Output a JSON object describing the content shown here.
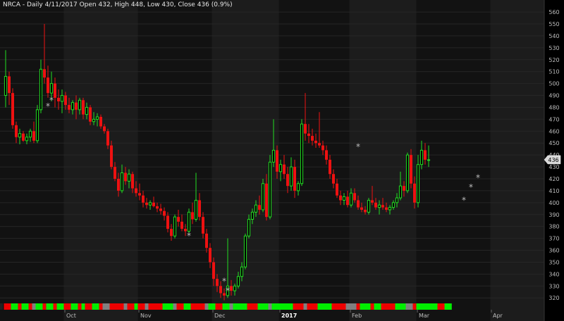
{
  "title": "NRCA - Daily 4/11/2017  Open 432,  High 448,  Low 430,  Close 436 (0.9%)",
  "colors": {
    "background": "#000000",
    "panel_dark": "#121212",
    "panel_light": "#1c1c1c",
    "up": "#22dd22",
    "down": "#ee1111",
    "neutral": "#888888",
    "axis_text": "#bdbdbd"
  },
  "chart_data": {
    "type": "candlestick",
    "ylim": [
      316,
      563
    ],
    "yticks": [
      320,
      330,
      340,
      350,
      360,
      370,
      380,
      390,
      400,
      410,
      420,
      430,
      440,
      450,
      460,
      470,
      480,
      490,
      500,
      510,
      520,
      530,
      540,
      550,
      560
    ],
    "xticks": [
      {
        "label": "Oct",
        "index": 17,
        "bold": false
      },
      {
        "label": "Nov",
        "index": 38,
        "bold": false
      },
      {
        "label": "Dec",
        "index": 59,
        "bold": false
      },
      {
        "label": "2017",
        "index": 78,
        "bold": true
      },
      {
        "label": "Feb",
        "index": 98,
        "bold": false
      },
      {
        "label": "Mar",
        "index": 117,
        "bold": false
      },
      {
        "label": "Apr",
        "index": 138,
        "bold": false
      }
    ],
    "last_close_label": "436",
    "candles": [
      [
        490,
        528,
        480,
        506
      ],
      [
        506,
        510,
        482,
        492
      ],
      [
        492,
        496,
        462,
        465
      ],
      [
        465,
        468,
        450,
        455
      ],
      [
        455,
        462,
        449,
        458
      ],
      [
        458,
        460,
        451,
        452
      ],
      [
        452,
        458,
        449,
        455
      ],
      [
        455,
        462,
        451,
        460
      ],
      [
        460,
        468,
        450,
        452
      ],
      [
        452,
        482,
        450,
        478
      ],
      [
        478,
        520,
        475,
        512
      ],
      [
        512,
        550,
        500,
        505
      ],
      [
        505,
        515,
        488,
        492
      ],
      [
        492,
        510,
        485,
        500
      ],
      [
        500,
        505,
        480,
        488
      ],
      [
        488,
        495,
        478,
        485
      ],
      [
        485,
        495,
        475,
        490
      ],
      [
        490,
        493,
        478,
        482
      ],
      [
        482,
        488,
        475,
        478
      ],
      [
        478,
        486,
        474,
        484
      ],
      [
        484,
        490,
        470,
        478
      ],
      [
        478,
        488,
        474,
        486
      ],
      [
        486,
        488,
        470,
        474
      ],
      [
        474,
        484,
        470,
        480
      ],
      [
        480,
        482,
        465,
        468
      ],
      [
        468,
        476,
        465,
        470
      ],
      [
        470,
        475,
        464,
        472
      ],
      [
        472,
        474,
        462,
        464
      ],
      [
        464,
        466,
        458,
        460
      ],
      [
        460,
        462,
        445,
        448
      ],
      [
        448,
        452,
        428,
        430
      ],
      [
        430,
        434,
        418,
        420
      ],
      [
        420,
        425,
        405,
        410
      ],
      [
        410,
        432,
        408,
        425
      ],
      [
        425,
        430,
        415,
        418
      ],
      [
        418,
        428,
        412,
        424
      ],
      [
        424,
        426,
        408,
        412
      ],
      [
        412,
        418,
        405,
        408
      ],
      [
        408,
        416,
        402,
        406
      ],
      [
        406,
        410,
        396,
        400
      ],
      [
        400,
        404,
        395,
        398
      ],
      [
        398,
        402,
        394,
        400
      ],
      [
        400,
        405,
        396,
        397
      ],
      [
        397,
        400,
        392,
        395
      ],
      [
        395,
        399,
        390,
        393
      ],
      [
        393,
        396,
        385,
        389
      ],
      [
        389,
        392,
        375,
        378
      ],
      [
        378,
        382,
        368,
        372
      ],
      [
        372,
        390,
        370,
        388
      ],
      [
        388,
        394,
        380,
        384
      ],
      [
        384,
        390,
        376,
        378
      ],
      [
        378,
        382,
        372,
        376
      ],
      [
        376,
        395,
        374,
        392
      ],
      [
        392,
        400,
        382,
        386
      ],
      [
        386,
        425,
        384,
        402
      ],
      [
        402,
        408,
        385,
        388
      ],
      [
        388,
        392,
        370,
        374
      ],
      [
        374,
        378,
        358,
        362
      ],
      [
        362,
        366,
        345,
        350
      ],
      [
        350,
        354,
        330,
        336
      ],
      [
        336,
        340,
        325,
        330
      ],
      [
        330,
        334,
        320,
        324
      ],
      [
        324,
        328,
        318,
        322
      ],
      [
        322,
        370,
        320,
        330
      ],
      [
        330,
        335,
        322,
        326
      ],
      [
        326,
        332,
        322,
        330
      ],
      [
        330,
        342,
        328,
        338
      ],
      [
        338,
        350,
        334,
        346
      ],
      [
        346,
        374,
        344,
        372
      ],
      [
        372,
        390,
        370,
        386
      ],
      [
        386,
        395,
        382,
        392
      ],
      [
        392,
        402,
        388,
        398
      ],
      [
        398,
        406,
        390,
        394
      ],
      [
        394,
        420,
        392,
        416
      ],
      [
        416,
        424,
        385,
        388
      ],
      [
        388,
        440,
        386,
        434
      ],
      [
        434,
        470,
        430,
        444
      ],
      [
        444,
        448,
        420,
        426
      ],
      [
        426,
        436,
        418,
        432
      ],
      [
        432,
        440,
        420,
        424
      ],
      [
        424,
        430,
        408,
        414
      ],
      [
        414,
        438,
        410,
        430
      ],
      [
        430,
        436,
        404,
        410
      ],
      [
        410,
        418,
        406,
        416
      ],
      [
        416,
        470,
        414,
        466
      ],
      [
        466,
        492,
        452,
        458
      ],
      [
        458,
        466,
        450,
        456
      ],
      [
        456,
        462,
        448,
        452
      ],
      [
        452,
        458,
        446,
        450
      ],
      [
        450,
        476,
        446,
        448
      ],
      [
        448,
        452,
        440,
        444
      ],
      [
        444,
        448,
        432,
        436
      ],
      [
        436,
        440,
        420,
        424
      ],
      [
        424,
        428,
        412,
        416
      ],
      [
        416,
        420,
        404,
        406
      ],
      [
        406,
        410,
        398,
        402
      ],
      [
        402,
        408,
        398,
        405
      ],
      [
        405,
        410,
        396,
        398
      ],
      [
        398,
        412,
        396,
        408
      ],
      [
        408,
        412,
        400,
        402
      ],
      [
        402,
        406,
        394,
        396
      ],
      [
        396,
        400,
        392,
        394
      ],
      [
        394,
        397,
        390,
        392
      ],
      [
        392,
        404,
        390,
        402
      ],
      [
        402,
        414,
        398,
        400
      ],
      [
        400,
        404,
        394,
        396
      ],
      [
        396,
        402,
        390,
        398
      ],
      [
        398,
        404,
        394,
        396
      ],
      [
        396,
        400,
        392,
        394
      ],
      [
        394,
        398,
        390,
        396
      ],
      [
        396,
        402,
        394,
        400
      ],
      [
        400,
        408,
        396,
        404
      ],
      [
        404,
        426,
        402,
        414
      ],
      [
        414,
        418,
        405,
        410
      ],
      [
        410,
        442,
        408,
        440
      ],
      [
        440,
        445,
        412,
        416
      ],
      [
        416,
        422,
        395,
        400
      ],
      [
        400,
        440,
        396,
        432
      ],
      [
        432,
        452,
        428,
        444
      ],
      [
        444,
        450,
        432,
        436
      ],
      [
        436,
        448,
        430,
        436
      ]
    ],
    "ribbon": [
      "red",
      "red",
      "green",
      "green",
      "red",
      "green",
      "green",
      "red",
      "gray",
      "green",
      "green",
      "red",
      "green",
      "green",
      "red",
      "green",
      "green",
      "red",
      "red",
      "green",
      "green",
      "red",
      "green",
      "red",
      "red",
      "green",
      "green",
      "red",
      "gray",
      "gray",
      "red",
      "red",
      "red",
      "red",
      "gray",
      "red",
      "red",
      "green",
      "red",
      "red",
      "gray",
      "red",
      "red",
      "red",
      "red",
      "green",
      "green",
      "green",
      "gray",
      "red",
      "red",
      "green",
      "green",
      "red",
      "red",
      "red",
      "red",
      "gray",
      "green",
      "green",
      "red",
      "red",
      "green",
      "green",
      "gray",
      "green",
      "green",
      "green",
      "green",
      "red",
      "red",
      "red",
      "green",
      "green",
      "green",
      "gray",
      "green",
      "green",
      "green",
      "green",
      "green",
      "green",
      "red",
      "red",
      "red",
      "gray",
      "red",
      "red",
      "red",
      "green",
      "green",
      "green",
      "green",
      "red",
      "red",
      "red",
      "red",
      "gray",
      "gray",
      "gray",
      "red",
      "green",
      "green",
      "green",
      "red",
      "green",
      "green",
      "red",
      "red",
      "red",
      "red",
      "green",
      "green",
      "green",
      "gray",
      "gray",
      "red",
      "green",
      "green",
      "green",
      "green",
      "green",
      "green",
      "red",
      "red",
      "green",
      "green"
    ],
    "stars": [
      [
        13,
        486
      ],
      [
        12,
        481
      ],
      [
        52,
        372
      ],
      [
        62,
        334
      ],
      [
        63,
        326
      ],
      [
        100,
        447
      ],
      [
        132,
        413
      ],
      [
        130,
        402
      ],
      [
        134,
        421
      ]
    ]
  }
}
